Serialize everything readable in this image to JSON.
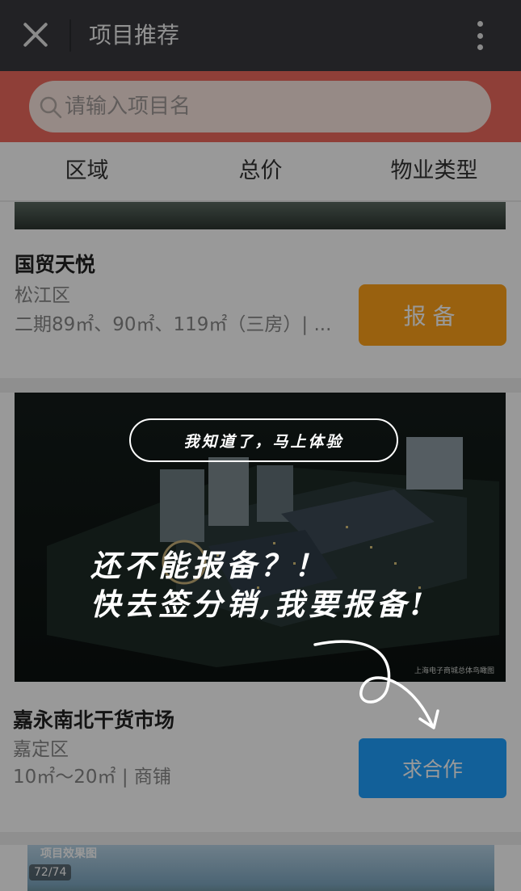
{
  "topbar": {
    "title": "项目推荐"
  },
  "search": {
    "placeholder": "请输入项目名"
  },
  "filters": [
    "区域",
    "总价",
    "物业类型"
  ],
  "listings": [
    {
      "name": "国贸天悦",
      "region": "松江区",
      "spec": "二期89㎡、90㎡、119㎡（三房）| ...",
      "action": "报备"
    },
    {
      "name": "嘉永南北干货市场",
      "region": "嘉定区",
      "spec": "10㎡～20㎡ | 商铺",
      "action": "求合作",
      "image_caption": "上海电子商城总体鸟瞰图"
    },
    {
      "image_label": "项目效果图",
      "image_counter": "72/74"
    }
  ],
  "guide": {
    "dismiss": "我知道了，马上体验",
    "line1": "还不能报备？！",
    "line2": "快去签分销,我要报备!"
  },
  "colors": {
    "topbar": "#393a3f",
    "search_band": "#ee6a5e",
    "report_button": "#ffa21a",
    "cooperate_button": "#1ea0ff"
  },
  "icons": [
    "close-icon",
    "more-vertical-icon",
    "search-icon",
    "curved-arrow-icon"
  ]
}
